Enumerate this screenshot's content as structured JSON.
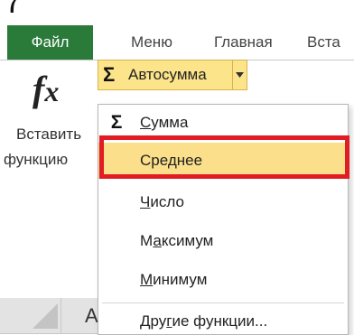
{
  "doc_fragment": "(",
  "tabs": {
    "file": "Файл",
    "menu": "Меню",
    "home": "Главная",
    "insert": "Вста"
  },
  "ribbon": {
    "insert_function_icon": "fx-icon",
    "insert_function_line1": "Вставить",
    "insert_function_line2": "функцию",
    "autosum_symbol": "Σ",
    "autosum_label": "Автосумма"
  },
  "dropdown": {
    "items": [
      {
        "icon": "Σ",
        "pre": "",
        "accel": "С",
        "post": "умма"
      },
      {
        "icon": "",
        "pre": "Сре",
        "accel": "д",
        "post": "нее"
      },
      {
        "icon": "",
        "pre": "",
        "accel": "Ч",
        "post": "исло"
      },
      {
        "icon": "",
        "pre": "М",
        "accel": "а",
        "post": "ксимум"
      },
      {
        "icon": "",
        "pre": "",
        "accel": "М",
        "post": "инимум"
      },
      {
        "icon": "",
        "pre": "Дру",
        "accel": "г",
        "post": "ие функции..."
      }
    ],
    "highlighted_index": 1
  },
  "grid": {
    "column_header": "А"
  },
  "colors": {
    "file_tab": "#2a7a3a",
    "autosum_bg": "#fce48a",
    "highlight_bg": "#fbdf8a",
    "annotation_frame": "#e01c24"
  }
}
